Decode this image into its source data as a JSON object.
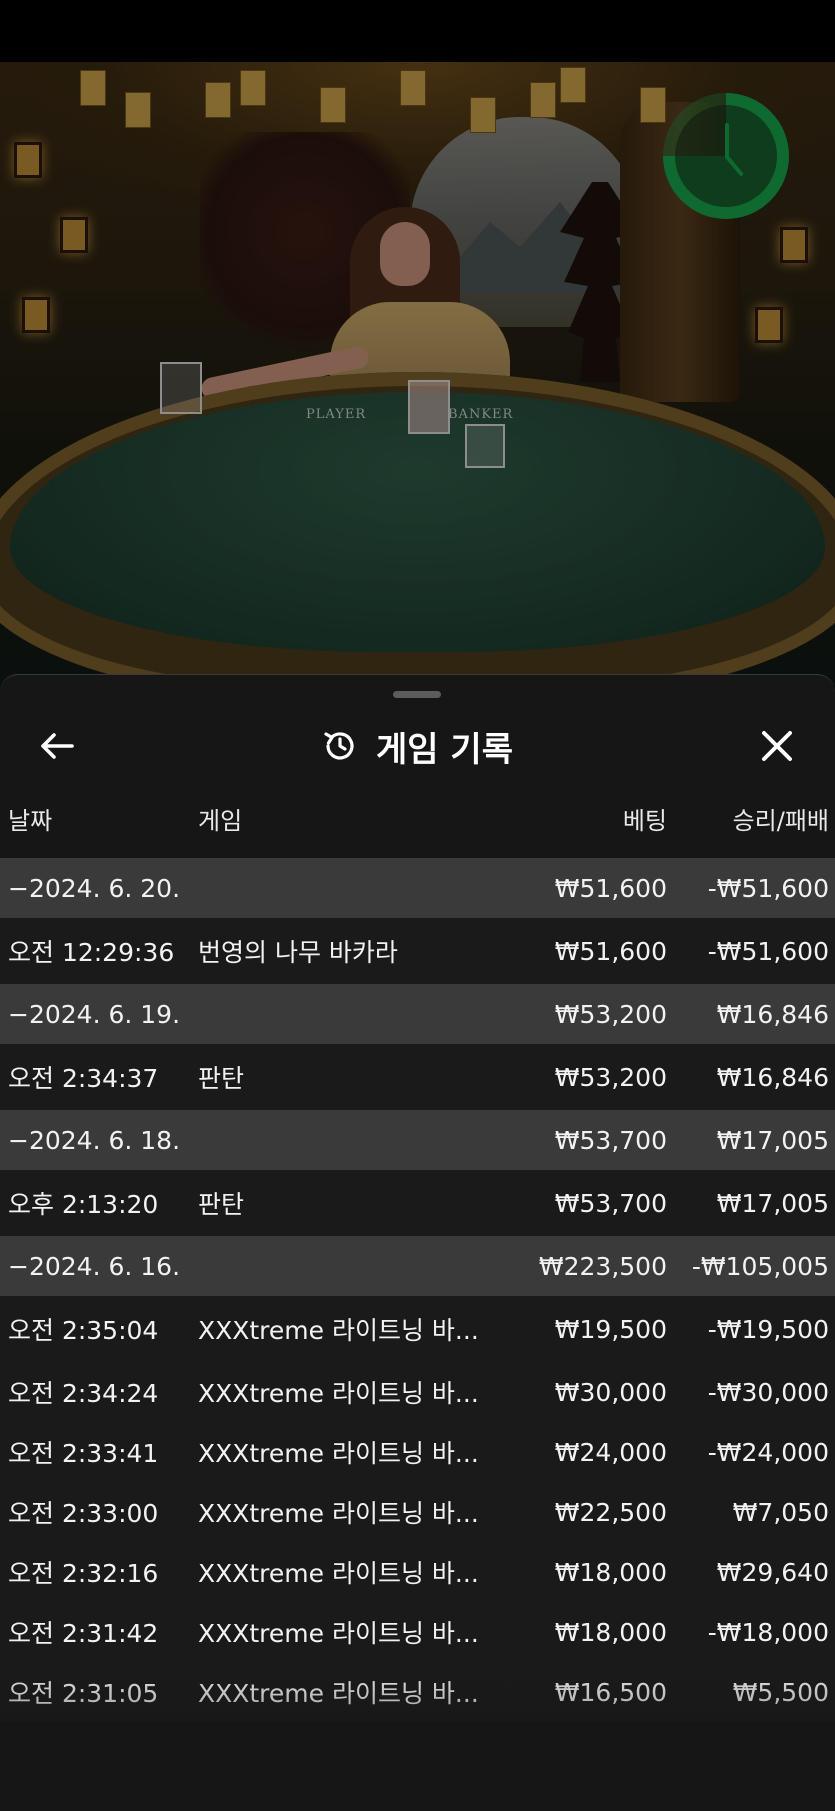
{
  "header": {
    "title": "게임 기록",
    "back_icon": "arrow-left-icon",
    "history_icon": "history-icon",
    "close_icon": "close-icon"
  },
  "video": {
    "table_labels": {
      "player": "PLAYER",
      "banker": "BANKER"
    },
    "timer_icon": "clock-icon",
    "accent_color": "#17a34a"
  },
  "columns": {
    "date": "날짜",
    "game": "게임",
    "bet": "베팅",
    "win_loss": "승리/패배"
  },
  "history": [
    {
      "type": "date",
      "label": "−2024. 6. 20.",
      "bet": "₩51,600",
      "win_loss": "-₩51,600"
    },
    {
      "type": "entry",
      "time": "오전 12:29:36",
      "game": "번영의 나무 바카라",
      "bet": "₩51,600",
      "win_loss": "-₩51,600"
    },
    {
      "type": "date",
      "label": "−2024. 6. 19.",
      "bet": "₩53,200",
      "win_loss": "₩16,846"
    },
    {
      "type": "entry",
      "time": "오전 2:34:37",
      "game": "판탄",
      "bet": "₩53,200",
      "win_loss": "₩16,846"
    },
    {
      "type": "date",
      "label": "−2024. 6. 18.",
      "bet": "₩53,700",
      "win_loss": "₩17,005"
    },
    {
      "type": "entry",
      "time": "오후 2:13:20",
      "game": "판탄",
      "bet": "₩53,700",
      "win_loss": "₩17,005"
    },
    {
      "type": "date",
      "label": "−2024. 6. 16.",
      "bet": "₩223,500",
      "win_loss": "-₩105,005"
    },
    {
      "type": "entry",
      "time": "오전 2:35:04",
      "game": "XXXtreme 라이트닝 바...",
      "bet": "₩19,500",
      "win_loss": "-₩19,500"
    },
    {
      "type": "entry",
      "time": "오전 2:34:24",
      "game": "XXXtreme 라이트닝 바...",
      "bet": "₩30,000",
      "win_loss": "-₩30,000"
    },
    {
      "type": "entry",
      "time": "오전 2:33:41",
      "game": "XXXtreme 라이트닝 바...",
      "bet": "₩24,000",
      "win_loss": "-₩24,000"
    },
    {
      "type": "entry",
      "time": "오전 2:33:00",
      "game": "XXXtreme 라이트닝 바...",
      "bet": "₩22,500",
      "win_loss": "₩7,050"
    },
    {
      "type": "entry",
      "time": "오전 2:32:16",
      "game": "XXXtreme 라이트닝 바...",
      "bet": "₩18,000",
      "win_loss": "₩29,640"
    },
    {
      "type": "entry",
      "time": "오전 2:31:42",
      "game": "XXXtreme 라이트닝 바...",
      "bet": "₩18,000",
      "win_loss": "-₩18,000"
    },
    {
      "type": "entry",
      "time": "오전 2:31:05",
      "game": "XXXtreme 라이트닝 바...",
      "bet": "₩16,500",
      "win_loss": "₩5,500"
    }
  ]
}
